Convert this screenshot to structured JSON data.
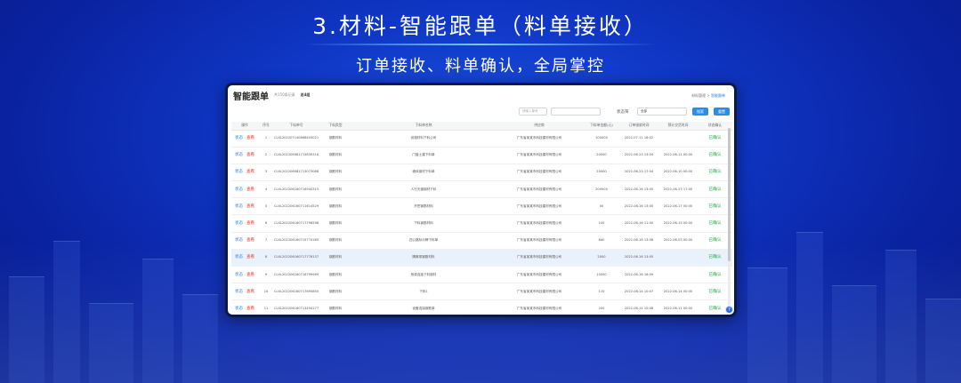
{
  "slide": {
    "headline": "3.材料-智能跟单（料单接收）",
    "subline": "订单接收、料单确认，全局掌控"
  },
  "app": {
    "title": "智能跟单",
    "count_text": "共150条记录",
    "count_text2": "总4组",
    "breadcrumb": [
      "材料管理",
      "智能跟单"
    ],
    "filters": {
      "input1_placeholder": "请输入单号",
      "input2_placeholder": "",
      "status_label": "状态筛",
      "select_value": "全部",
      "btn1": "搜索",
      "btn2": "重置"
    },
    "columns": [
      "操作",
      "序号",
      "下料单号",
      "下料类型",
      "下料单名称",
      "供应商",
      "下料单金额(元)",
      "订单接收时间",
      "预计交货时间",
      "状态确认"
    ],
    "actions": {
      "track": "状态",
      "view": "查看"
    },
    "status_value": "已确认",
    "rows": [
      {
        "no": "1",
        "code": "CLXL2022071408684030210005130",
        "type": "钢筋材料",
        "name": "设施材料下料公司",
        "supplier": "广东省某某市科技建材有限公司",
        "amount": "100000",
        "recv": "2022-07-11 18:02",
        "due": ""
      },
      {
        "no": "2",
        "code": "CLXL20220608171583931621196433",
        "type": "钢筋材料",
        "name": "门窗土建下料单",
        "supplier": "广东省某某市科技建材有限公司",
        "amount": "20000",
        "recv": "2022-06-23 13:04",
        "due": "2022-06-11 00:00"
      },
      {
        "no": "3",
        "code": "CLXL20220608171307308860171132",
        "type": "钢筋材料",
        "name": "墙体钢材下料单",
        "supplier": "广东省某某市科技建材有限公司",
        "amount": "25000",
        "recv": "2022-06-23 17:04",
        "due": "2022-06-10 00:00"
      },
      {
        "no": "4",
        "code": "CLXL20220616071694431597271576",
        "type": "钢筋材料",
        "name": "人行天道钢材下料",
        "supplier": "广东省某某市科技建材有限公司",
        "amount": "200000",
        "recv": "2022-06-16 13:05",
        "due": "2022-06-23 17:00"
      },
      {
        "no": "5",
        "code": "CLXL20220616071161452922270396",
        "type": "钢筋材料",
        "name": "开挖钢筋材料",
        "supplier": "广东省某某市科技建材有限公司",
        "amount": "50",
        "recv": "2022-06-16 13:00",
        "due": "2022-06-17 00:00"
      },
      {
        "no": "6",
        "code": "CLXL20220616071779659892271172",
        "type": "钢筋材料",
        "name": "下料钢筋材料",
        "supplier": "广东省某某市科技建材有限公司",
        "amount": "100",
        "recv": "2022-06-16 11:00",
        "due": "2022-06-15 00:00"
      },
      {
        "no": "7",
        "code": "CLXL20220616071577416552405025",
        "type": "钢筋材料",
        "name": "四公路标示牌下料单",
        "supplier": "广东省某某市科技建材有限公司",
        "amount": "640",
        "recv": "2022-06-16 13:08",
        "due": "2022-06-03 00:00"
      },
      {
        "no": "8",
        "code": "CLXL20220616071777813734576053",
        "type": "钢筋材料",
        "name": "隔离带钢筋材料",
        "supplier": "广东省某某市科技建材有限公司",
        "amount": "2000",
        "recv": "2022-06-16 13:05",
        "due": ""
      },
      {
        "no": "9",
        "code": "CLXL20220616071879996977023025",
        "type": "钢筋材料",
        "name": "桥梁连接下料钢材",
        "supplier": "广东省某某市科技建材有限公司",
        "amount": "10000",
        "recv": "2022-06-16 16:09",
        "due": ""
      },
      {
        "no": "10",
        "code": "CLXL20220616071769585001003106",
        "type": "钢筋材料",
        "name": "下料1",
        "supplier": "广东省某某市科技建材有限公司",
        "amount": "110",
        "recv": "2022-06-14 10:07",
        "due": "2022-06-14 00:00"
      },
      {
        "no": "11",
        "code": "CLXL20220616071349417735051440",
        "type": "钢筋材料",
        "name": "设备连接钢筋单",
        "supplier": "广东省某某市科技建材有限公司",
        "amount": "200",
        "recv": "2022-06-14 10:08",
        "due": "2022-06-11 00:00"
      }
    ]
  }
}
